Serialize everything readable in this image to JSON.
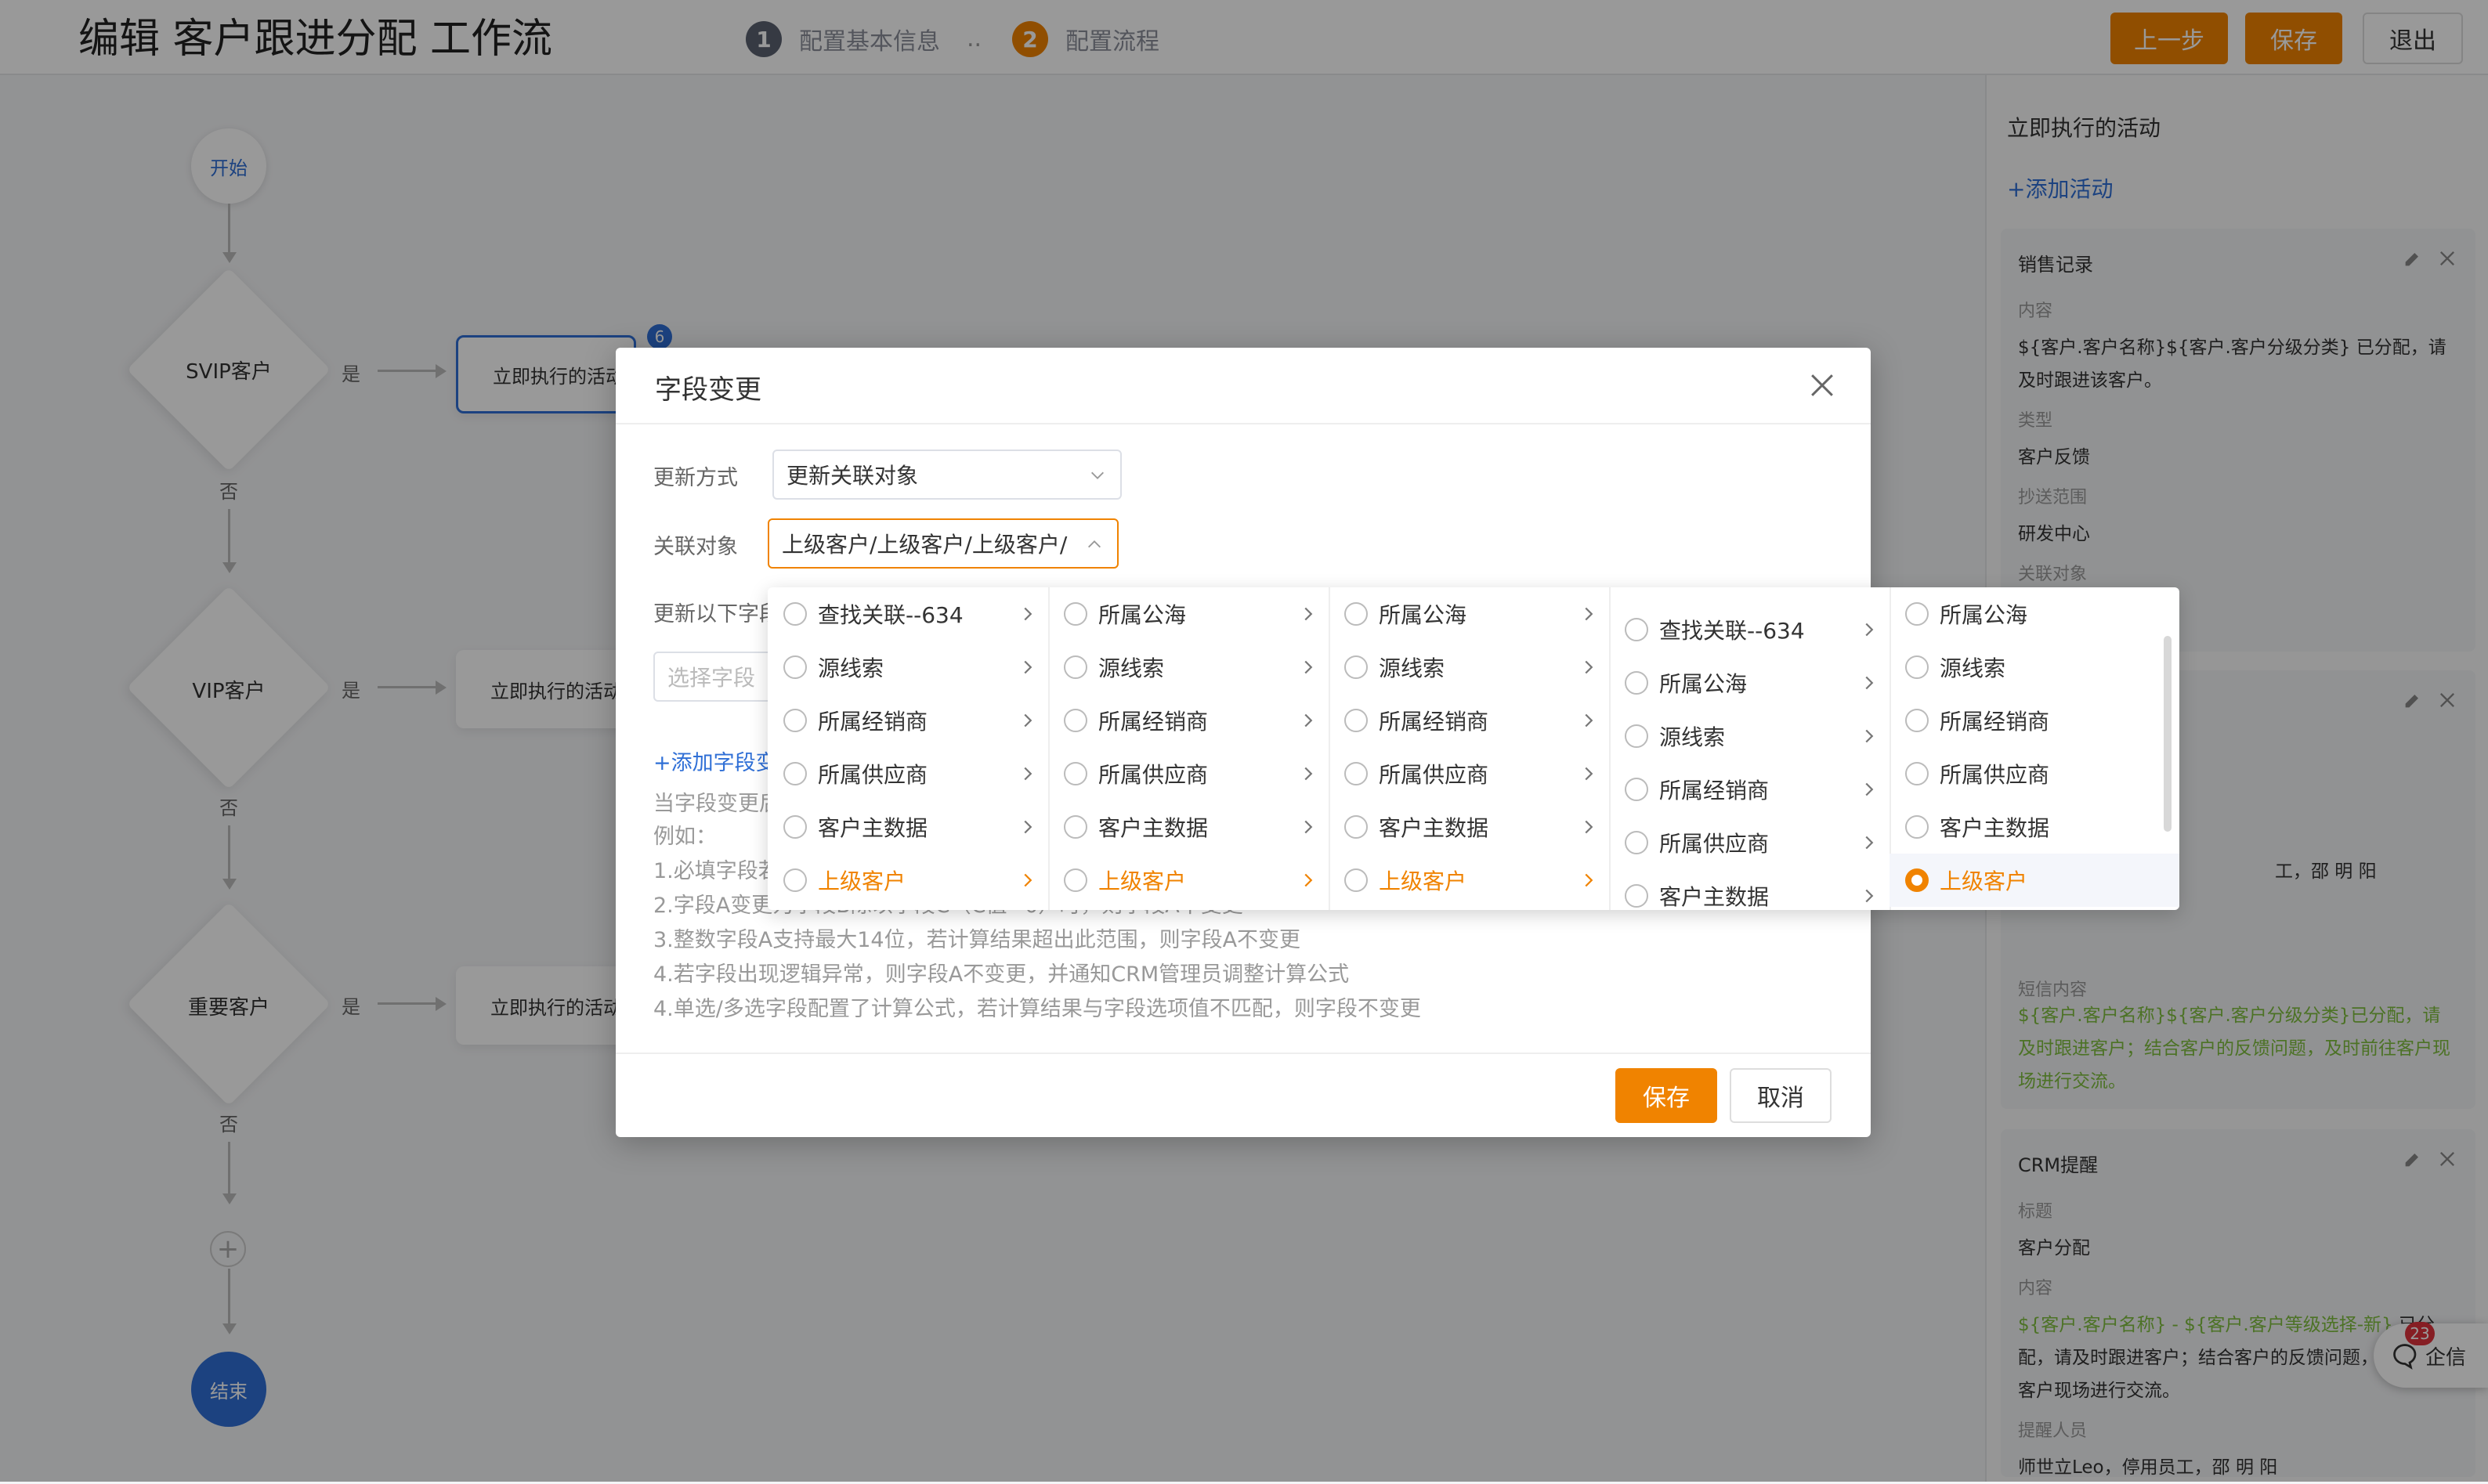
{
  "header": {
    "title": "编辑 客户跟进分配 工作流",
    "steps": [
      {
        "num": "1",
        "label": "配置基本信息"
      },
      {
        "num": "2",
        "label": "配置流程"
      }
    ],
    "step_separator": "..",
    "prev_label": "上一步",
    "save_label": "保存",
    "exit_label": "退出"
  },
  "flow": {
    "start_label": "开始",
    "end_label": "结束",
    "badge_count": "6",
    "conditions": [
      {
        "label": "SVIP客户",
        "yes": "是",
        "no": "否",
        "node": "立即执行的活动"
      },
      {
        "label": "VIP客户",
        "yes": "是",
        "no": "否",
        "node": "立即执行的活动"
      },
      {
        "label": "重要客户",
        "yes": "是",
        "no": "否",
        "node": "立即执行的活动"
      }
    ],
    "add_symbol": "+"
  },
  "right_panel": {
    "title": "立即执行的活动",
    "add_activity": "+添加活动",
    "cards": [
      {
        "title": "销售记录",
        "content_label": "内容",
        "content": "${客户.客户名称}${客户.客户分级分类} 已分配，请及时跟进该客户。",
        "type_label": "类型",
        "type": "客户反馈",
        "cc_label": "抄送范围",
        "cc": "研发中心",
        "obj_label": "关联对象"
      },
      {
        "partial_people": "工，邵 明 阳",
        "sms_label": "短信内容",
        "sms": "${客户.客户名称}${客户.客户分级分类}已分配，请及时跟进客户；结合客户的反馈问题，及时前往客户现场进行交流。"
      },
      {
        "title": "CRM提醒",
        "title_label": "标题",
        "title_value": "客户分配",
        "content_label": "内容",
        "content_green": "${客户.客户名称} - ${客户.客户等级选择-新}",
        "content_rest": " 已分配，请及时跟进客户；结合客户的反馈问题，及时前往客户现场进行交流。",
        "people_label": "提醒人员",
        "people": "师世立Leo，停用员工，邵 明 阳"
      }
    ]
  },
  "modal": {
    "title": "字段变更",
    "update_mode_label": "更新方式",
    "update_mode_value": "更新关联对象",
    "related_label": "关联对象",
    "related_value": "上级客户/上级客户/上级客户/",
    "update_fields_label": "更新以下字段",
    "select_field_placeholder": "选择字段",
    "add_field": "+添加字段变更",
    "hints": [
      "当字段变更后",
      "例如：",
      "1.必填字段若",
      "2.字段A变更为字段B除以字段C（C值=0）时，则字段A不变更",
      "3.整数字段A支持最大14位，若计算结果超出此范围，则字段A不变更",
      "4.若字段出现逻辑异常，则字段A不变更，并通知CRM管理员调整计算公式",
      "4.单选/多选字段配置了计算公式，若计算结果与字段选项值不匹配，则字段不变更"
    ],
    "save_label": "保存",
    "cancel_label": "取消"
  },
  "cascader": {
    "columns": [
      [
        "查找关联--634",
        "源线索",
        "所属经销商",
        "所属供应商",
        "客户主数据",
        "上级客户"
      ],
      [
        "所属公海",
        "源线索",
        "所属经销商",
        "所属供应商",
        "客户主数据",
        "上级客户"
      ],
      [
        "所属公海",
        "源线索",
        "所属经销商",
        "所属供应商",
        "客户主数据",
        "上级客户"
      ],
      [
        "查找关联--634",
        "所属公海",
        "源线索",
        "所属经销商",
        "所属供应商",
        "客户主数据"
      ],
      [
        "所属公海",
        "源线索",
        "所属经销商",
        "所属供应商",
        "客户主数据",
        "上级客户"
      ]
    ]
  },
  "floating": {
    "label": "企信",
    "badge": "23"
  },
  "colors": {
    "accent": "#f08300",
    "link": "#2f6fd6",
    "end_node": "#2f6fd6",
    "green": "#7fbf3f"
  }
}
